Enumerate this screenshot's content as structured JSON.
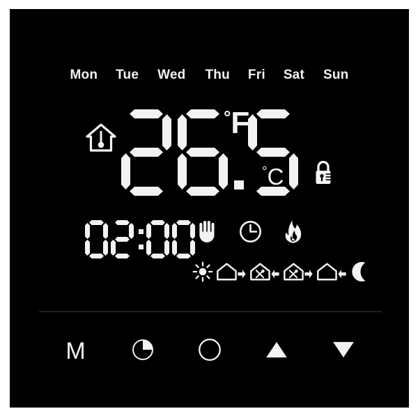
{
  "device": {
    "type": "programmable-thermostat-lcd",
    "screen_background": "#000000",
    "segment_color": "#f2f2f2",
    "divider_color": "#3a3a3a"
  },
  "weekdays": [
    {
      "label": "Mon",
      "active": false
    },
    {
      "label": "Tue",
      "active": false
    },
    {
      "label": "Wed",
      "active": false
    },
    {
      "label": "Thu",
      "active": false
    },
    {
      "label": "Fri",
      "active": false
    },
    {
      "label": "Sat",
      "active": false
    },
    {
      "label": "Sun",
      "active": false
    }
  ],
  "temperature": {
    "value": "26.5",
    "digits": [
      "2",
      "6",
      ".",
      "5"
    ],
    "unit_primary": "°F",
    "unit_primary_degree": "°",
    "unit_primary_letter": "F",
    "unit_secondary": "°C",
    "unit_secondary_degree": "°",
    "unit_secondary_letter": "C",
    "room_icon": "house-thermometer-icon"
  },
  "lock": {
    "icon": "padlock-locked-icon",
    "state": "locked"
  },
  "clock": {
    "time": "02:00",
    "hours": "02",
    "minutes": "00",
    "separator": ":"
  },
  "status_icons": [
    {
      "name": "hand-manual-icon",
      "label": "Manual"
    },
    {
      "name": "clock-program-icon",
      "label": "Program"
    },
    {
      "name": "flame-heating-icon",
      "label": "Heating"
    }
  ],
  "mode_icons": [
    {
      "name": "sun-wake-icon",
      "label": "Wake"
    },
    {
      "name": "house-leave-icon",
      "label": "Leave"
    },
    {
      "name": "house-meal-return-icon",
      "label": "Lunch Return"
    },
    {
      "name": "house-meal-leave-icon",
      "label": "Lunch Leave"
    },
    {
      "name": "house-return-icon",
      "label": "Return"
    },
    {
      "name": "moon-sleep-icon",
      "label": "Sleep"
    }
  ],
  "buttons": [
    {
      "name": "mode-button",
      "label": "M",
      "icon": "letter-m"
    },
    {
      "name": "clock-button",
      "label": "",
      "icon": "clock-quarter-icon"
    },
    {
      "name": "power-button",
      "label": "",
      "icon": "circle-power-icon"
    },
    {
      "name": "up-button",
      "label": "",
      "icon": "triangle-up-icon"
    },
    {
      "name": "down-button",
      "label": "",
      "icon": "triangle-down-icon"
    }
  ]
}
